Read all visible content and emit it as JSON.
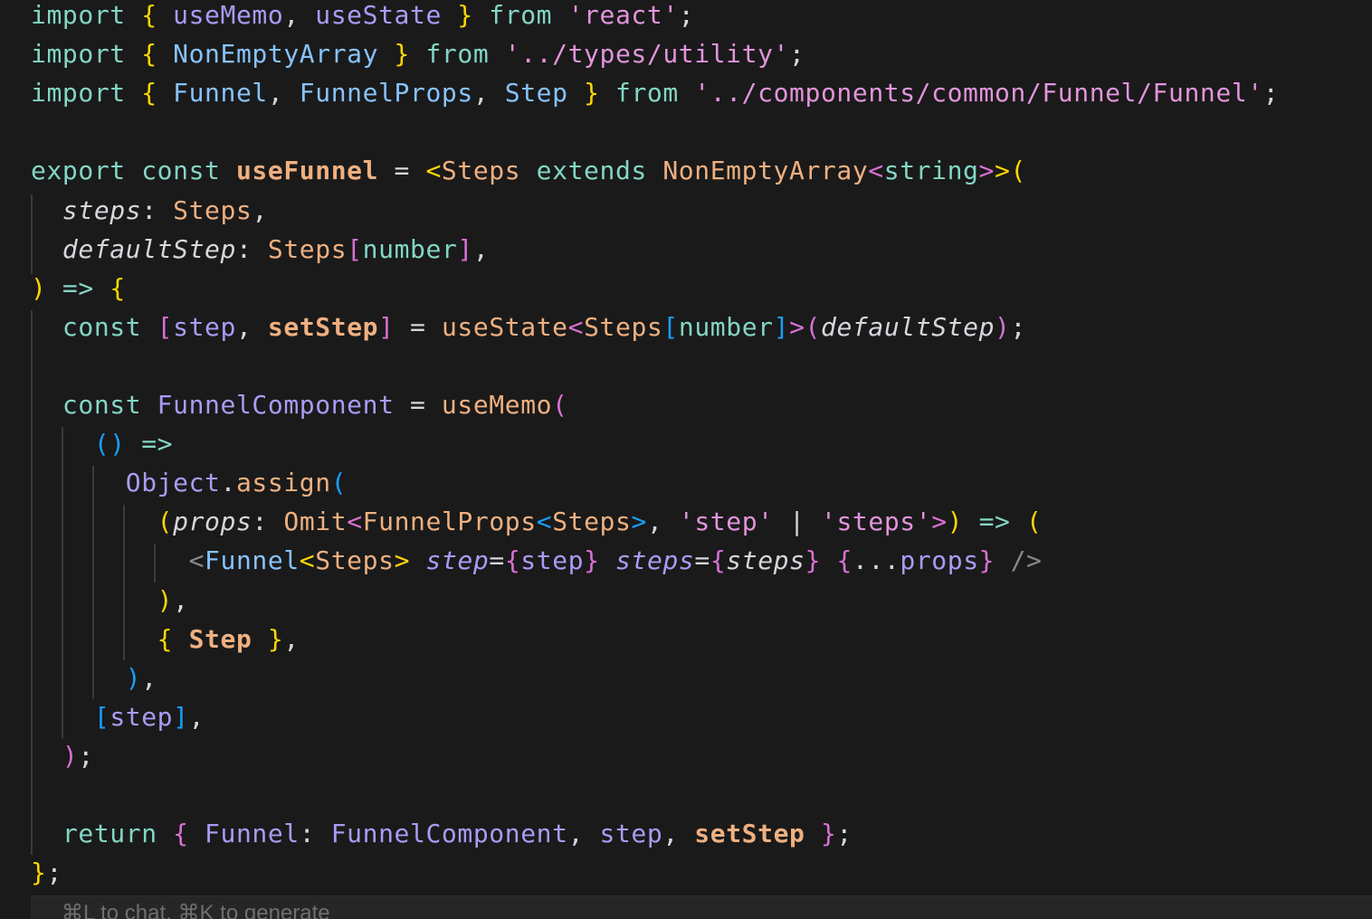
{
  "editor": {
    "language": "typescript",
    "lines": [
      [
        {
          "c": "kw",
          "t": "import "
        },
        {
          "c": "br1",
          "t": "{ "
        },
        {
          "c": "id",
          "t": "useMemo"
        },
        {
          "c": "pl",
          "t": ", "
        },
        {
          "c": "id",
          "t": "useState"
        },
        {
          "c": "br1",
          "t": " }"
        },
        {
          "c": "kw",
          "t": " from "
        },
        {
          "c": "str",
          "t": "'react'"
        },
        {
          "c": "pl",
          "t": ";"
        }
      ],
      [
        {
          "c": "kw",
          "t": "import "
        },
        {
          "c": "br1",
          "t": "{ "
        },
        {
          "c": "tag",
          "t": "NonEmptyArray"
        },
        {
          "c": "br1",
          "t": " }"
        },
        {
          "c": "kw",
          "t": " from "
        },
        {
          "c": "str",
          "t": "'../types/utility'"
        },
        {
          "c": "pl",
          "t": ";"
        }
      ],
      [
        {
          "c": "kw",
          "t": "import "
        },
        {
          "c": "br1",
          "t": "{ "
        },
        {
          "c": "tag",
          "t": "Funnel"
        },
        {
          "c": "pl",
          "t": ", "
        },
        {
          "c": "tag",
          "t": "FunnelProps"
        },
        {
          "c": "pl",
          "t": ", "
        },
        {
          "c": "tag",
          "t": "Step"
        },
        {
          "c": "br1",
          "t": " }"
        },
        {
          "c": "kw",
          "t": " from "
        },
        {
          "c": "str",
          "t": "'../components/common/Funnel/Funnel'"
        },
        {
          "c": "pl",
          "t": ";"
        }
      ],
      [],
      [
        {
          "c": "kw",
          "t": "export const "
        },
        {
          "c": "fn",
          "t": "useFunnel"
        },
        {
          "c": "op",
          "t": " = "
        },
        {
          "c": "br1",
          "t": "<"
        },
        {
          "c": "ty",
          "t": "Steps"
        },
        {
          "c": "kw",
          "t": " extends "
        },
        {
          "c": "ty",
          "t": "NonEmptyArray"
        },
        {
          "c": "br2",
          "t": "<"
        },
        {
          "c": "kw",
          "t": "string"
        },
        {
          "c": "br2",
          "t": ">"
        },
        {
          "c": "br1",
          "t": ">("
        }
      ],
      [
        {
          "c": "pl",
          "t": "  "
        },
        {
          "c": "prm",
          "t": "steps"
        },
        {
          "c": "pl",
          "t": ": "
        },
        {
          "c": "ty",
          "t": "Steps"
        },
        {
          "c": "pl",
          "t": ","
        }
      ],
      [
        {
          "c": "pl",
          "t": "  "
        },
        {
          "c": "prm",
          "t": "defaultStep"
        },
        {
          "c": "pl",
          "t": ": "
        },
        {
          "c": "ty",
          "t": "Steps"
        },
        {
          "c": "br2",
          "t": "["
        },
        {
          "c": "kw",
          "t": "number"
        },
        {
          "c": "br2",
          "t": "]"
        },
        {
          "c": "pl",
          "t": ","
        }
      ],
      [
        {
          "c": "br1",
          "t": ")"
        },
        {
          "c": "kw",
          "t": " => "
        },
        {
          "c": "br1",
          "t": "{"
        }
      ],
      [
        {
          "c": "pl",
          "t": "  "
        },
        {
          "c": "kw",
          "t": "const "
        },
        {
          "c": "br2",
          "t": "["
        },
        {
          "c": "id",
          "t": "step"
        },
        {
          "c": "pl",
          "t": ", "
        },
        {
          "c": "fn",
          "t": "setStep"
        },
        {
          "c": "br2",
          "t": "]"
        },
        {
          "c": "op",
          "t": " = "
        },
        {
          "c": "fnc",
          "t": "useState"
        },
        {
          "c": "br2",
          "t": "<"
        },
        {
          "c": "ty",
          "t": "Steps"
        },
        {
          "c": "br3",
          "t": "["
        },
        {
          "c": "kw",
          "t": "number"
        },
        {
          "c": "br3",
          "t": "]"
        },
        {
          "c": "br2",
          "t": ">("
        },
        {
          "c": "prm",
          "t": "defaultStep"
        },
        {
          "c": "br2",
          "t": ")"
        },
        {
          "c": "pl",
          "t": ";"
        }
      ],
      [],
      [
        {
          "c": "pl",
          "t": "  "
        },
        {
          "c": "kw",
          "t": "const "
        },
        {
          "c": "id",
          "t": "FunnelComponent"
        },
        {
          "c": "op",
          "t": " = "
        },
        {
          "c": "fnc",
          "t": "useMemo"
        },
        {
          "c": "br2",
          "t": "("
        }
      ],
      [
        {
          "c": "pl",
          "t": "    "
        },
        {
          "c": "br3",
          "t": "()"
        },
        {
          "c": "kw",
          "t": " =>"
        }
      ],
      [
        {
          "c": "pl",
          "t": "      "
        },
        {
          "c": "id",
          "t": "Object"
        },
        {
          "c": "pl",
          "t": "."
        },
        {
          "c": "fnc",
          "t": "assign"
        },
        {
          "c": "br3",
          "t": "("
        }
      ],
      [
        {
          "c": "pl",
          "t": "        "
        },
        {
          "c": "br1",
          "t": "("
        },
        {
          "c": "prm",
          "t": "props"
        },
        {
          "c": "pl",
          "t": ": "
        },
        {
          "c": "ty",
          "t": "Omit"
        },
        {
          "c": "br2",
          "t": "<"
        },
        {
          "c": "ty",
          "t": "FunnelProps"
        },
        {
          "c": "br3",
          "t": "<"
        },
        {
          "c": "ty",
          "t": "Steps"
        },
        {
          "c": "br3",
          "t": ">"
        },
        {
          "c": "pl",
          "t": ", "
        },
        {
          "c": "str",
          "t": "'step'"
        },
        {
          "c": "op",
          "t": " | "
        },
        {
          "c": "str",
          "t": "'steps'"
        },
        {
          "c": "br2",
          "t": ">"
        },
        {
          "c": "br1",
          "t": ")"
        },
        {
          "c": "kw",
          "t": " => "
        },
        {
          "c": "br1",
          "t": "("
        }
      ],
      [
        {
          "c": "pl",
          "t": "          "
        },
        {
          "c": "cm",
          "t": "<"
        },
        {
          "c": "tag",
          "t": "Funnel"
        },
        {
          "c": "br1",
          "t": "<"
        },
        {
          "c": "ty",
          "t": "Steps"
        },
        {
          "c": "br1",
          "t": ">"
        },
        {
          "c": "pl",
          "t": " "
        },
        {
          "c": "prm2",
          "t": "step"
        },
        {
          "c": "pl",
          "t": "="
        },
        {
          "c": "br2",
          "t": "{"
        },
        {
          "c": "id",
          "t": "step"
        },
        {
          "c": "br2",
          "t": "}"
        },
        {
          "c": "pl",
          "t": " "
        },
        {
          "c": "prm2",
          "t": "steps"
        },
        {
          "c": "pl",
          "t": "="
        },
        {
          "c": "br2",
          "t": "{"
        },
        {
          "c": "prm",
          "t": "steps"
        },
        {
          "c": "br2",
          "t": "}"
        },
        {
          "c": "pl",
          "t": " "
        },
        {
          "c": "br2",
          "t": "{"
        },
        {
          "c": "pl",
          "t": "..."
        },
        {
          "c": "id",
          "t": "props"
        },
        {
          "c": "br2",
          "t": "}"
        },
        {
          "c": "cm",
          "t": " />"
        }
      ],
      [
        {
          "c": "pl",
          "t": "        "
        },
        {
          "c": "br1",
          "t": ")"
        },
        {
          "c": "pl",
          "t": ","
        }
      ],
      [
        {
          "c": "pl",
          "t": "        "
        },
        {
          "c": "br1",
          "t": "{ "
        },
        {
          "c": "fn",
          "t": "Step"
        },
        {
          "c": "br1",
          "t": " }"
        },
        {
          "c": "pl",
          "t": ","
        }
      ],
      [
        {
          "c": "pl",
          "t": "      "
        },
        {
          "c": "br3",
          "t": ")"
        },
        {
          "c": "pl",
          "t": ","
        }
      ],
      [
        {
          "c": "pl",
          "t": "    "
        },
        {
          "c": "br3",
          "t": "["
        },
        {
          "c": "id",
          "t": "step"
        },
        {
          "c": "br3",
          "t": "]"
        },
        {
          "c": "pl",
          "t": ","
        }
      ],
      [
        {
          "c": "pl",
          "t": "  "
        },
        {
          "c": "br2",
          "t": ")"
        },
        {
          "c": "pl",
          "t": ";"
        }
      ],
      [],
      [
        {
          "c": "pl",
          "t": "  "
        },
        {
          "c": "kw",
          "t": "return "
        },
        {
          "c": "br2",
          "t": "{ "
        },
        {
          "c": "id",
          "t": "Funnel"
        },
        {
          "c": "pl",
          "t": ": "
        },
        {
          "c": "id",
          "t": "FunnelComponent"
        },
        {
          "c": "pl",
          "t": ", "
        },
        {
          "c": "id",
          "t": "step"
        },
        {
          "c": "pl",
          "t": ", "
        },
        {
          "c": "fn",
          "t": "setStep"
        },
        {
          "c": "br2",
          "t": " }"
        },
        {
          "c": "pl",
          "t": ";"
        }
      ],
      [
        {
          "c": "br1",
          "t": "}"
        },
        {
          "c": "pl",
          "t": ";"
        }
      ]
    ]
  },
  "hint": {
    "text": "⌘L to chat, ⌘K to generate"
  },
  "theme": {
    "background": "#1a1a1a",
    "keyword": "#83d6c5",
    "identifier": "#aa9bf5",
    "string": "#e394dc",
    "bracket_1": "#ffd700",
    "bracket_2": "#da70d6",
    "bracket_3": "#179fff",
    "function": "#efb080",
    "type": "#87c3ff"
  }
}
